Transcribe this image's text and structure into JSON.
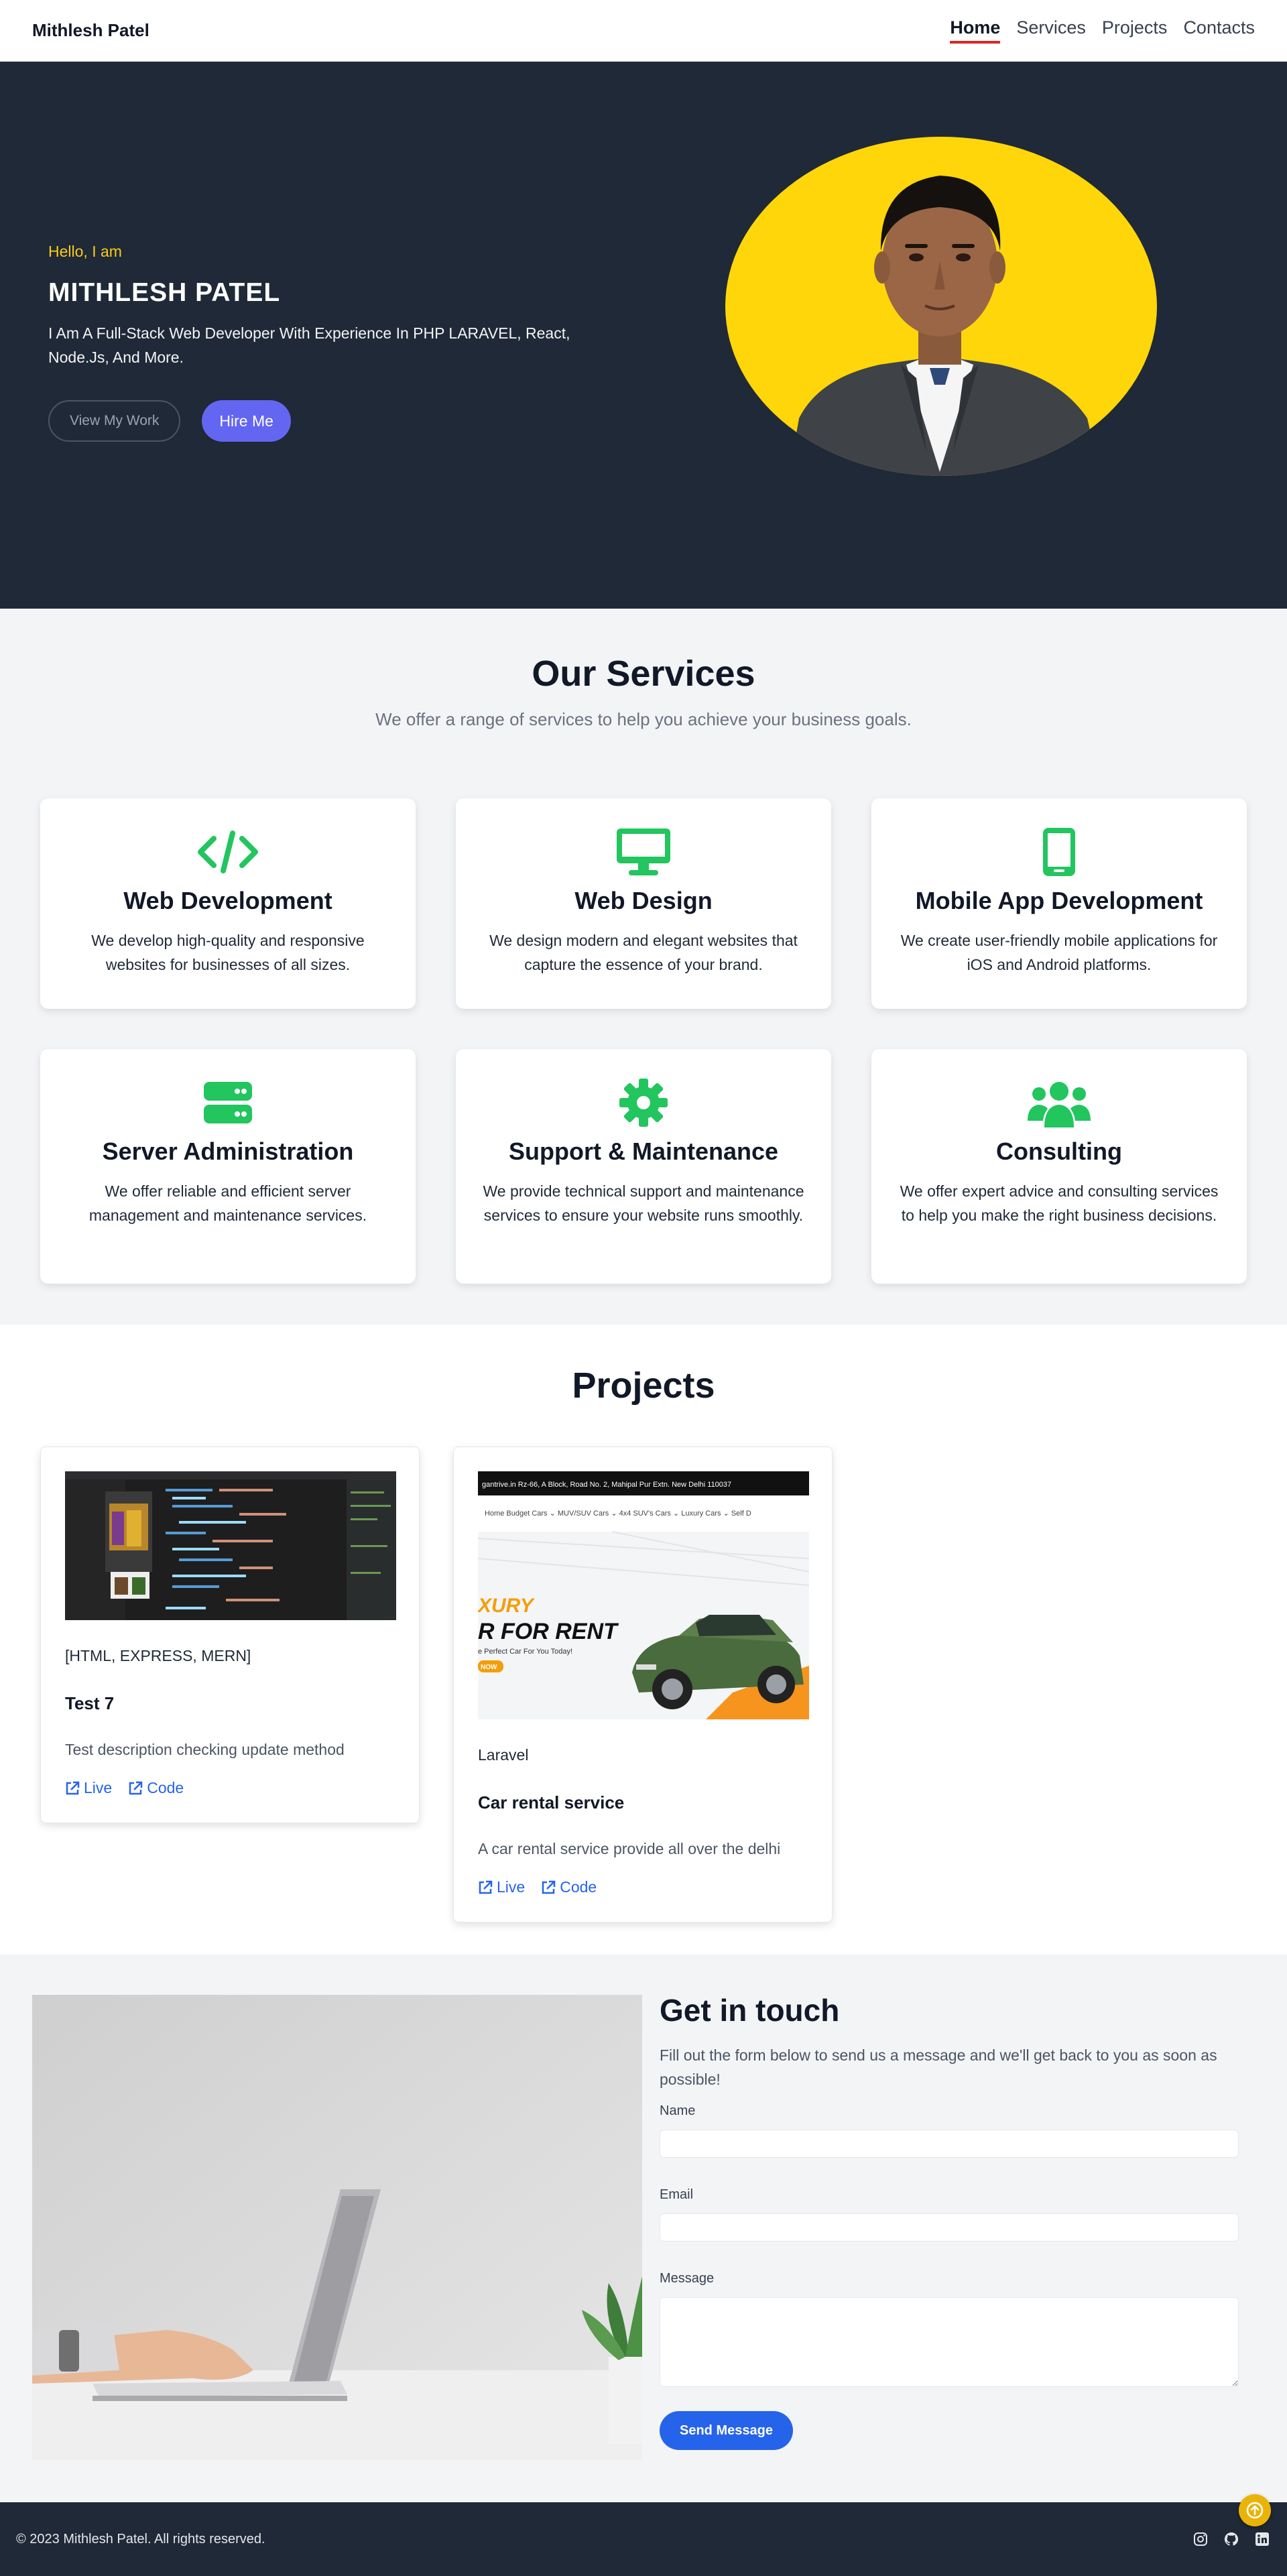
{
  "nav": {
    "brand": "Mithlesh Patel",
    "links": [
      {
        "label": "Home",
        "active": true
      },
      {
        "label": "Services",
        "active": false
      },
      {
        "label": "Projects",
        "active": false
      },
      {
        "label": "Contacts",
        "active": false
      }
    ],
    "active_underline_color": "#dc2626"
  },
  "hero": {
    "greeting": "Hello, I am",
    "name": "MITHLESH PATEL",
    "description": "I Am A Full-Stack Web Developer With Experience In PHP LARAVEL, React, Node.Js, And More.",
    "view_work_label": "View My Work",
    "hire_me_label": "Hire Me",
    "accent_color": "#facc15",
    "button_color": "#6366f1"
  },
  "services": {
    "title": "Our Services",
    "subtitle": "We offer a range of services to help you achieve your business goals.",
    "icon_color": "#22c55e",
    "items": [
      {
        "icon": "code-icon",
        "title": "Web Development",
        "desc": "We develop high-quality and responsive websites for businesses of all sizes."
      },
      {
        "icon": "desktop-icon",
        "title": "Web Design",
        "desc": "We design modern and elegant websites that capture the essence of your brand."
      },
      {
        "icon": "mobile-icon",
        "title": "Mobile App Development",
        "desc": "We create user-friendly mobile applications for iOS and Android platforms."
      },
      {
        "icon": "server-icon",
        "title": "Server Administration",
        "desc": "We offer reliable and efficient server management and maintenance services."
      },
      {
        "icon": "gear-icon",
        "title": "Support & Maintenance",
        "desc": "We provide technical support and maintenance services to ensure your website runs smoothly."
      },
      {
        "icon": "users-icon",
        "title": "Consulting",
        "desc": "We offer expert advice and consulting services to help you make the right business decisions."
      }
    ]
  },
  "projects": {
    "title": "Projects",
    "items": [
      {
        "tags": "[HTML, EXPRESS, MERN]",
        "title": "Test 7",
        "desc": "Test description checking update method",
        "live_label": "Live",
        "code_label": "Code"
      },
      {
        "tags": "Laravel",
        "title": "Car rental service",
        "desc": "A car rental service provide all over the delhi",
        "live_label": "Live",
        "code_label": "Code",
        "thumb": {
          "topbar": "gantrive.in   Rz-66, A Block, Road No. 2, Mahipal Pur Extn. New Delhi 110037",
          "menu": "Home    Budget Cars ⌄    MUV/SUV Cars ⌄    4x4 SUV's Cars ⌄    Luxury Cars ⌄    Self D",
          "headline1": "XURY",
          "headline2": "R FOR RENT",
          "tagline": "e Perfect Car For You Today!",
          "badge": "NOW"
        }
      }
    ]
  },
  "contact": {
    "title": "Get in touch",
    "intro": "Fill out the form below to send us a message and we'll get back to you as soon as possible!",
    "name_label": "Name",
    "email_label": "Email",
    "message_label": "Message",
    "send_label": "Send Message"
  },
  "footer": {
    "copyright": "© 2023 Mithlesh Patel. All rights reserved.",
    "socials": [
      "instagram-icon",
      "github-icon",
      "linkedin-icon"
    ]
  }
}
